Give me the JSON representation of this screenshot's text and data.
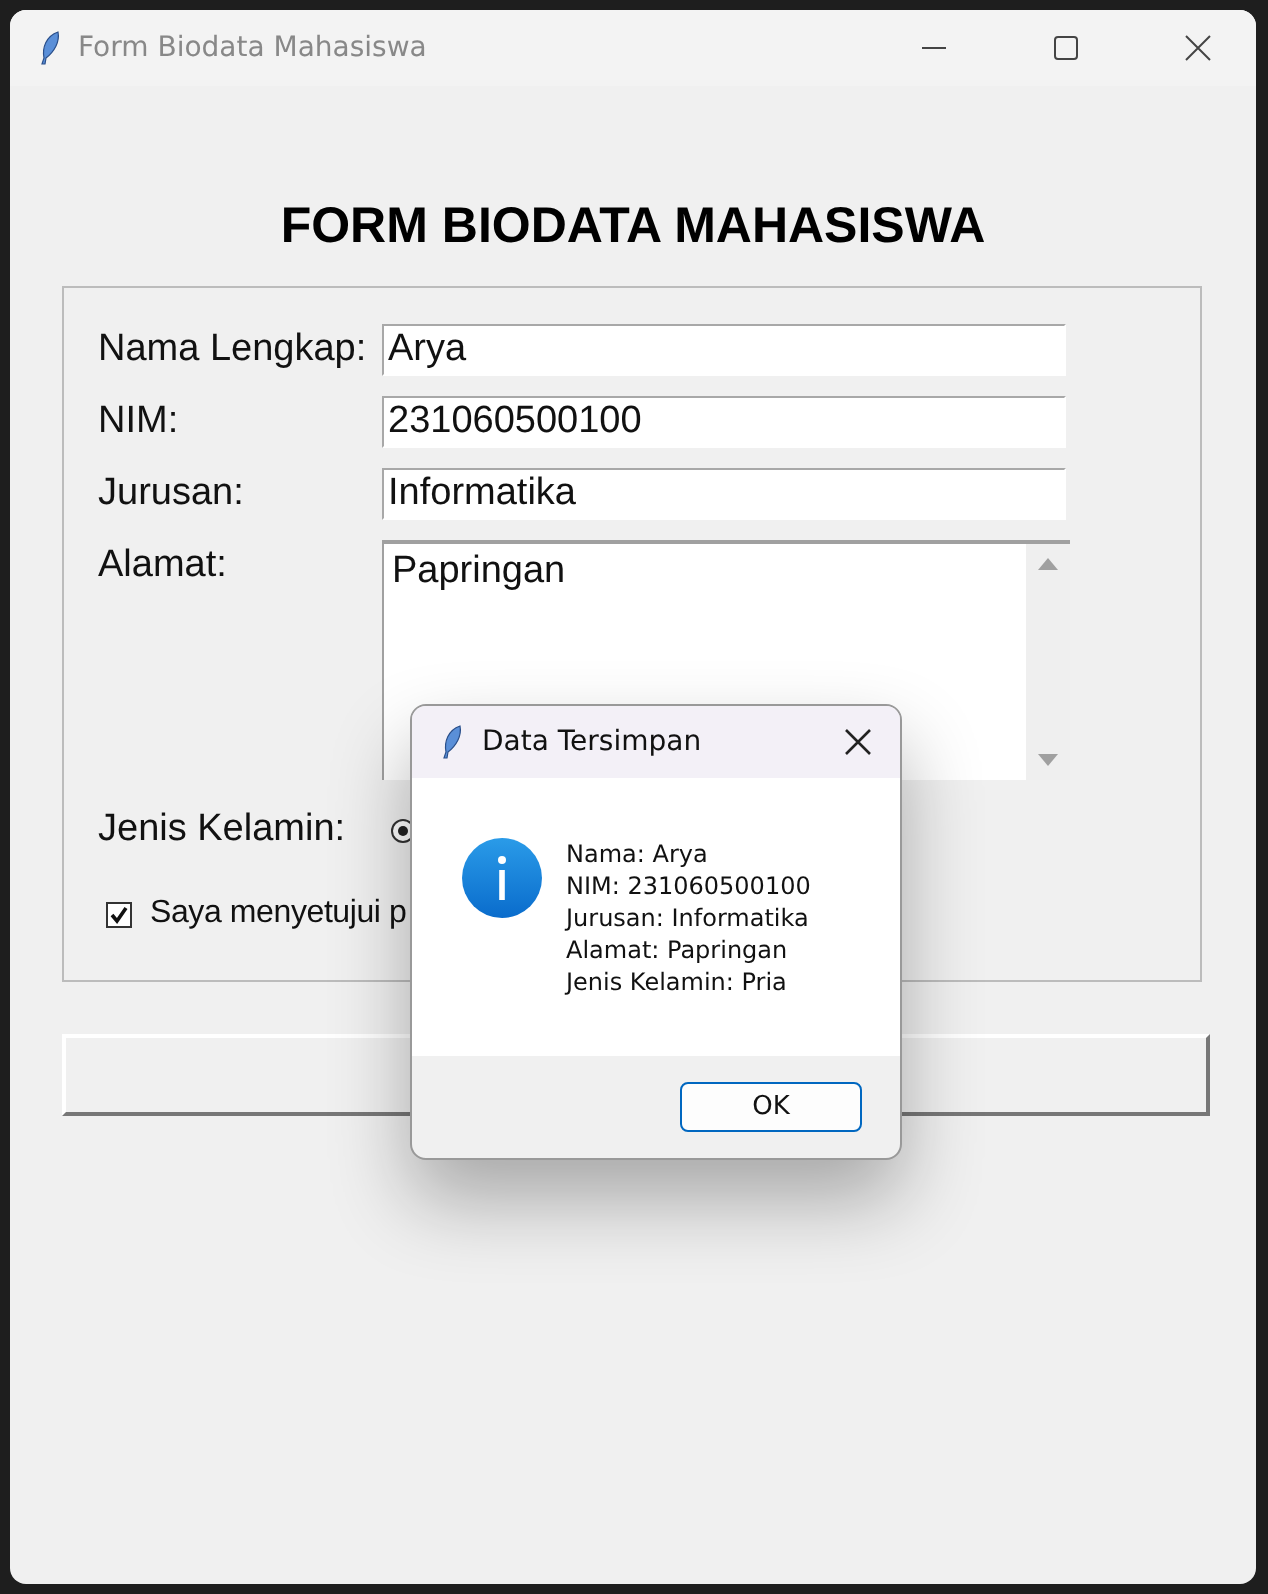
{
  "window": {
    "title": "Form Biodata Mahasiswa"
  },
  "heading": "FORM BIODATA MAHASISWA",
  "fields": [
    {
      "label": "Nama Lengkap:",
      "value": "Arya",
      "kind": "entry"
    },
    {
      "label": "NIM:",
      "value": "231060500100",
      "kind": "entry"
    },
    {
      "label": "Jurusan:",
      "value": "Informatika",
      "kind": "entry"
    },
    {
      "label": "Alamat:",
      "value": "Papringan",
      "kind": "textarea"
    }
  ],
  "gender": {
    "label": "Jenis Kelamin:",
    "radio_selected": true
  },
  "agreement": {
    "label": "Saya menyetujui p",
    "checked": true
  },
  "dialog": {
    "title": "Data Tersimpan",
    "lines": [
      "Nama: Arya",
      "NIM: 231060500100",
      "Jurusan: Informatika",
      "Alamat: Papringan",
      "Jenis Kelamin: Pria"
    ],
    "button": "OK"
  }
}
